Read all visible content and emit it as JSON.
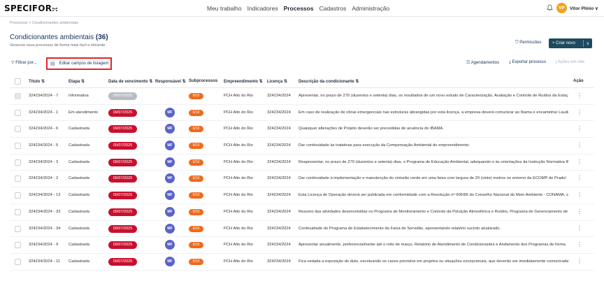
{
  "header": {
    "logo": "SPECIFOR",
    "logo_mark": ":·:",
    "nav": [
      "Meu trabalho",
      "Indicadores",
      "Processos",
      "Cadastros",
      "Administração"
    ],
    "active_nav": "Processos",
    "bell_icon": "bell-icon",
    "user_initials": "VP",
    "user_name": "Vitor Plínio ∨"
  },
  "breadcrumb": "Processos  >  Condicionantes ambientais",
  "page": {
    "title": "Condicionantes ambientais",
    "count": "(36)",
    "subtitle": "Gerencie seus processos de forma mais fácil e eficiente."
  },
  "actions": {
    "permissions": "Permissões",
    "create_new": "+ Criar novo",
    "create_chevron": "∨"
  },
  "toolbar": {
    "filter": "Filtrar por...",
    "edit_fields": "Editar campos de listagem",
    "schedules": "Agendamentos",
    "export": "Exportar processo",
    "batch": "Ações em lote"
  },
  "columns": {
    "title": "Título ⇅",
    "stage": "Etapa ⇅",
    "due": "Data de vencimento ⇅",
    "responsible": "Responsável ⇅",
    "subprocesses": "Subprocessos",
    "project": "Empreendimento ⇅",
    "license": "Licença ⇅",
    "description": "Descrição da condicionante ⇅",
    "action": "Ação"
  },
  "rows": [
    {
      "title": "324234/2024 - 7",
      "stage": "Informativa",
      "due": "09/07/2025",
      "resp": "",
      "sub": "9/10",
      "project": "PCH Alto do Rio",
      "license": "324234/2024",
      "desc": "Apresentar, no prazo de 270 (duzentos e setenta) dias, os resultados de um novo estudo de Caracterização, Avaliação e Controle de Ruídos da Estação"
    },
    {
      "title": "324234/2024 - 1",
      "stage": "Em atendimento",
      "due": "09/07/2025",
      "resp": "MF",
      "sub": "9/10",
      "project": "PCH Alto do Rio",
      "license": "324234/2024",
      "desc": "Em caso de realização de obras emergenciais nas estruturas abrangidas por esta licença, a empresa deverá comunicar ao Ibama e encaminhar Laudo"
    },
    {
      "title": "324234/2024 - 6",
      "stage": "Cadastrada",
      "due": "09/07/2025",
      "resp": "MF",
      "sub": "9/10",
      "project": "PCH Alto do Rio",
      "license": "324234/2024",
      "desc": "Quaisquer alterações de Projeto deverão ser precedidas de anuência do IBAMA."
    },
    {
      "title": "324234/2024 - 5",
      "stage": "Cadastrada",
      "due": "09/07/2025",
      "resp": "MF",
      "sub": "9/10",
      "project": "PCH Alto do Rio",
      "license": "324234/2024",
      "desc": "Dar continuidade às tratativas para execução da Compensação Ambiental do empreendimento."
    },
    {
      "title": "324234/2024 - 3",
      "stage": "Cadastrada",
      "due": "09/07/2025",
      "resp": "MF",
      "sub": "9/10",
      "project": "PCH Alto do Rio",
      "license": "324234/2024",
      "desc": "Reapresentar, no prazo de 270 (duzentos e setenta) dias, o Programa de Educação Ambiental, adequando-o às orientações da Instrução Normativa IB"
    },
    {
      "title": "324234/2024 - 2",
      "stage": "Cadastrada",
      "due": "09/07/2025",
      "resp": "MF",
      "sub": "9/10",
      "project": "PCH Alto do Rio",
      "license": "324234/2024",
      "desc": "Dar continuidade à implementação e manutenção do cinturão verde em uma faixa com largura de 20 (vinte) metros no entorno da ECOMP de Prado/"
    },
    {
      "title": "324234/2024 - 13",
      "stage": "Cadastrada",
      "due": "09/07/2025",
      "resp": "MF",
      "sub": "9/10",
      "project": "PCH Alto do Rio",
      "license": "324234/2024",
      "desc": "Esta Licença de Operação deverá ser publicada em conformidade com a Resolução nº 006/86 do Conselho Nacional do Meio Ambiente - CONAMA, se"
    },
    {
      "title": "324234/2024 - 33",
      "stage": "Cadastrada",
      "due": "09/07/2025",
      "resp": "MF",
      "sub": "9/10",
      "project": "PCH Alto do Rio",
      "license": "324234/2024",
      "desc": "Resumo das atividades desenvolvidas no Programa de Monitoramento e Controle da Poluição Atmosférica e Ruídos, Programa de Gerenciamento de"
    },
    {
      "title": "324234/2024 - 34",
      "stage": "Cadastrada",
      "due": "09/07/2025",
      "resp": "MF",
      "sub": "9/10",
      "project": "PCH Alto do Rio",
      "license": "324234/2024",
      "desc": "Continuidade do Programa de Estabelecimento da Faixa de Servidão, apresentando relatório sucinto atualizado."
    },
    {
      "title": "324234/2024 - 9",
      "stage": "Cadastrada",
      "due": "09/07/2025",
      "resp": "MF",
      "sub": "9/10",
      "project": "PCH Alto do Rio",
      "license": "324234/2024",
      "desc": "Apresentar anualmente, preferencialmente até o mês de março, Relatório de Atendimento de Condicionantes e Andamento dos Programas de forma"
    },
    {
      "title": "324234/2024 - 11",
      "stage": "Cadastrada",
      "due": "09/07/2025",
      "resp": "MF",
      "sub": "9/10",
      "project": "PCH Alto do Rio",
      "license": "324234/2024",
      "desc": "Fica vedada a exposição do duto, excetuando os casos previstos em projetos ou situações excepcionais, que deverão ser imediatamente comunicada"
    }
  ],
  "colors": {
    "accent": "#1d4a5e",
    "date": "#c8102e",
    "sub": "#f06a1d",
    "avatar": "#5a63c9",
    "highlight": "#e3242b"
  }
}
